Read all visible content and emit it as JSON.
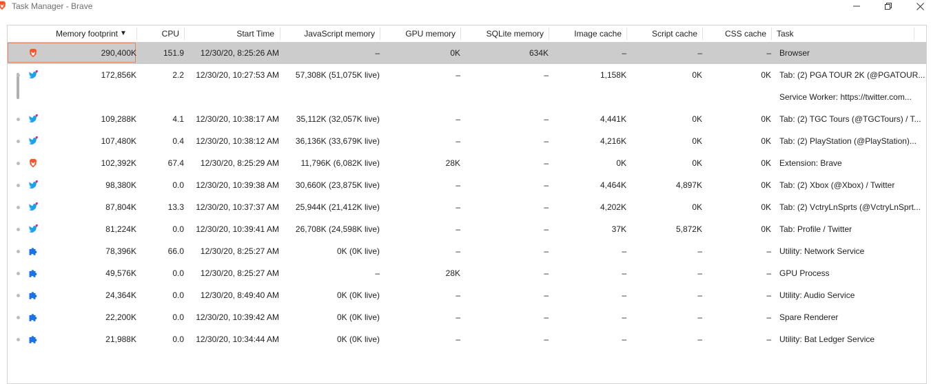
{
  "window": {
    "title": "Task Manager - Brave"
  },
  "columns": [
    "Memory footprint",
    "CPU",
    "Start Time",
    "JavaScript memory",
    "GPU memory",
    "SQLite memory",
    "Image cache",
    "Script cache",
    "CSS cache",
    "Task"
  ],
  "sort": {
    "column": "Memory footprint",
    "direction": "descending",
    "arrow": "▼"
  },
  "colors": {
    "brave": "#fb542b",
    "twitter": "#1da1f2",
    "puzzle": "#1a73e8",
    "selected_row": "#cccccc",
    "selected_border": "#e2836b"
  },
  "rows": [
    {
      "icon": "brave-lion-icon",
      "selected": true,
      "cells": [
        "290,400K",
        "151.9",
        "12/30/20, 8:25:26 AM",
        "–",
        "0K",
        "634K",
        "–",
        "–",
        "–",
        "Browser"
      ]
    },
    {
      "icon": "twitter-bird-icon",
      "cells": [
        "172,856K",
        "2.2",
        "12/30/20, 10:27:53 AM",
        "57,308K (51,075K live)",
        "–",
        "–",
        "1,158K",
        "0K",
        "0K",
        "Tab: (2) PGA TOUR 2K (@PGATOUR..."
      ]
    },
    {
      "icon": "",
      "cells": [
        "",
        "",
        "",
        "",
        "",
        "",
        "",
        "",
        "",
        "Service Worker: https://twitter.com..."
      ]
    },
    {
      "icon": "twitter-bird-icon",
      "cells": [
        "109,288K",
        "4.1",
        "12/30/20, 10:38:17 AM",
        "35,112K (32,057K live)",
        "–",
        "–",
        "4,441K",
        "0K",
        "0K",
        "Tab: (2) TGC Tours (@TGCTours) / T..."
      ]
    },
    {
      "icon": "twitter-bird-icon",
      "cells": [
        "107,480K",
        "0.4",
        "12/30/20, 10:38:12 AM",
        "36,136K (33,679K live)",
        "–",
        "–",
        "4,216K",
        "0K",
        "0K",
        "Tab: (2) PlayStation (@PlayStation)..."
      ]
    },
    {
      "icon": "brave-lion-icon",
      "cells": [
        "102,392K",
        "67.4",
        "12/30/20, 8:25:29 AM",
        "11,796K (6,082K live)",
        "28K",
        "–",
        "0K",
        "0K",
        "0K",
        "Extension: Brave"
      ]
    },
    {
      "icon": "twitter-bird-icon",
      "cells": [
        "98,380K",
        "0.0",
        "12/30/20, 10:39:38 AM",
        "30,660K (23,875K live)",
        "–",
        "–",
        "4,464K",
        "4,897K",
        "0K",
        "Tab: (2) Xbox (@Xbox) / Twitter"
      ]
    },
    {
      "icon": "twitter-bird-icon",
      "cells": [
        "87,804K",
        "13.3",
        "12/30/20, 10:37:37 AM",
        "25,944K (21,412K live)",
        "–",
        "–",
        "4,202K",
        "0K",
        "0K",
        "Tab: (2) VctryLnSprts (@VctryLnSprt..."
      ]
    },
    {
      "icon": "twitter-bird-icon",
      "cells": [
        "81,224K",
        "0.0",
        "12/30/20, 10:39:41 AM",
        "26,708K (24,598K live)",
        "–",
        "–",
        "37K",
        "5,872K",
        "0K",
        "Tab: Profile / Twitter"
      ]
    },
    {
      "icon": "puzzle-piece-icon",
      "cells": [
        "78,396K",
        "66.0",
        "12/30/20, 8:25:27 AM",
        "0K (0K live)",
        "–",
        "–",
        "–",
        "–",
        "–",
        "Utility: Network Service"
      ]
    },
    {
      "icon": "puzzle-piece-icon",
      "cells": [
        "49,576K",
        "0.0",
        "12/30/20, 8:25:27 AM",
        "–",
        "28K",
        "–",
        "–",
        "–",
        "–",
        "GPU Process"
      ]
    },
    {
      "icon": "puzzle-piece-icon",
      "cells": [
        "24,364K",
        "0.0",
        "12/30/20, 8:49:40 AM",
        "0K (0K live)",
        "–",
        "–",
        "–",
        "–",
        "–",
        "Utility: Audio Service"
      ]
    },
    {
      "icon": "puzzle-piece-icon",
      "cells": [
        "22,200K",
        "0.0",
        "12/30/20, 10:39:42 AM",
        "0K (0K live)",
        "–",
        "–",
        "–",
        "–",
        "–",
        "Spare Renderer"
      ]
    },
    {
      "icon": "puzzle-piece-icon",
      "cells": [
        "21,988K",
        "0.0",
        "12/30/20, 10:34:44 AM",
        "0K (0K live)",
        "–",
        "–",
        "–",
        "–",
        "–",
        "Utility: Bat Ledger Service"
      ]
    }
  ]
}
